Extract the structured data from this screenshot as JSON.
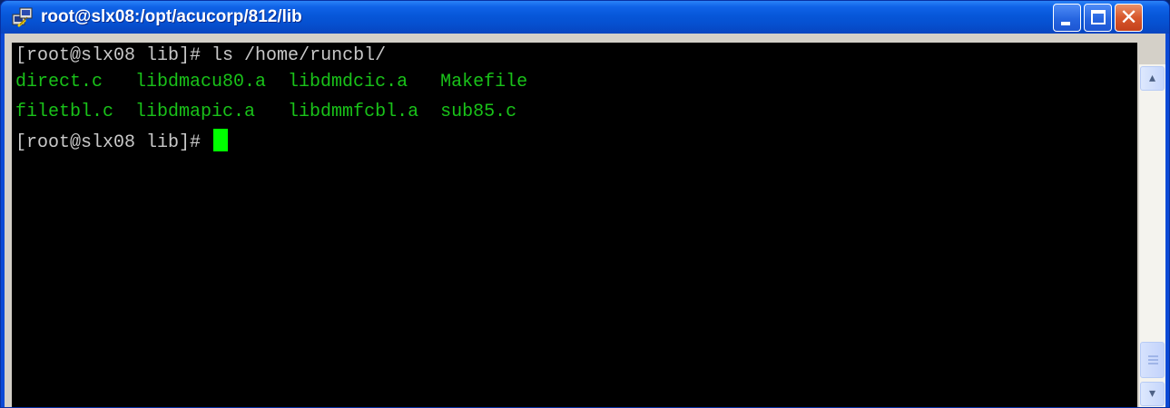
{
  "window": {
    "title": "root@slx08:/opt/acucorp/812/lib",
    "icon": "putty-terminal-icon",
    "controls": {
      "minimize": "minimize-icon",
      "maximize": "maximize-icon",
      "close": "close-icon",
      "close_glyph": "✕"
    }
  },
  "terminal": {
    "prompt_1": "[root@slx08 lib]# ",
    "command_1": "ls /home/runcbl/",
    "listing": {
      "row_1": "direct.c   libdmacu80.a  libdmdcic.a   Makefile",
      "row_2": "filetbl.c  libdmapic.a   libdmmfcbl.a  sub85.c"
    },
    "prompt_2": "[root@slx08 lib]# ",
    "cursor": "block-cursor",
    "colors": {
      "background": "#000000",
      "text": "#c8c8c8",
      "listing": "#19c219",
      "cursor": "#00ff00"
    }
  },
  "scrollbar": {
    "up_arrow": "▴",
    "down_arrow": "▾"
  }
}
